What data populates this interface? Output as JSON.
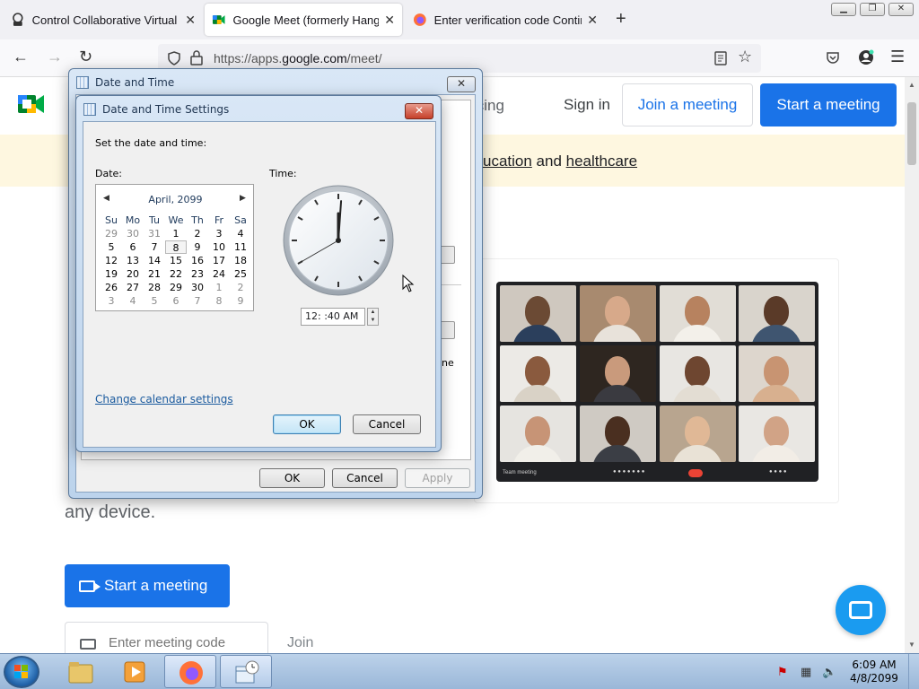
{
  "browser": {
    "tabs": [
      {
        "title": "Control Collaborative Virtual M...",
        "icon": "control-icon"
      },
      {
        "title": "Google Meet (formerly Hangou...",
        "icon": "google-meet-icon",
        "active": true
      },
      {
        "title": "Enter verification code Contin...",
        "icon": "firefox-icon"
      }
    ],
    "new_tab": "+",
    "url_prefix": "https://apps.",
    "url_domain": "google.com",
    "url_path": "/meet/"
  },
  "page": {
    "nav": {
      "pricing": "icing",
      "sign_in": "Sign in",
      "join": "Join a meeting",
      "start": "Start a meeting"
    },
    "banner": {
      "link1": "ucation",
      "and": " and ",
      "link2": "healthcare"
    },
    "hero": {
      "tail": "any device.",
      "start_button": "Start a meeting",
      "code_placeholder": "Enter meeting code",
      "join_link": "Join"
    },
    "video": {
      "meeting_name": "Team meeting"
    }
  },
  "dialog_outer": {
    "title": "Date and Time",
    "ok": "OK",
    "cancel": "Cancel",
    "apply": "Apply",
    "partial_text": "ne"
  },
  "dialog_inner": {
    "title": "Date and Time Settings",
    "instruction": "Set the date and time:",
    "date_label": "Date:",
    "time_label": "Time:",
    "calendar": {
      "month": "April, 2099",
      "weekdays": [
        "Su",
        "Mo",
        "Tu",
        "We",
        "Th",
        "Fr",
        "Sa"
      ],
      "weeks": [
        [
          "29",
          "30",
          "31",
          "1",
          "2",
          "3",
          "4"
        ],
        [
          "5",
          "6",
          "7",
          "8",
          "9",
          "10",
          "11"
        ],
        [
          "12",
          "13",
          "14",
          "15",
          "16",
          "17",
          "18"
        ],
        [
          "19",
          "20",
          "21",
          "22",
          "23",
          "24",
          "25"
        ],
        [
          "26",
          "27",
          "28",
          "29",
          "30",
          "1",
          "2"
        ],
        [
          "3",
          "4",
          "5",
          "6",
          "7",
          "8",
          "9"
        ]
      ],
      "selected": "8"
    },
    "time_value": "12: :40 AM",
    "clock": {
      "hour": 12,
      "minute": 0,
      "second": 40
    },
    "change_calendar_link": "Change calendar settings",
    "ok": "OK",
    "cancel": "Cancel"
  },
  "taskbar": {
    "time": "6:09 AM",
    "date": "4/8/2099"
  },
  "colors": {
    "google_blue": "#1a73e8",
    "banner_bg": "#fef7e0",
    "end_call": "#ea4335"
  }
}
